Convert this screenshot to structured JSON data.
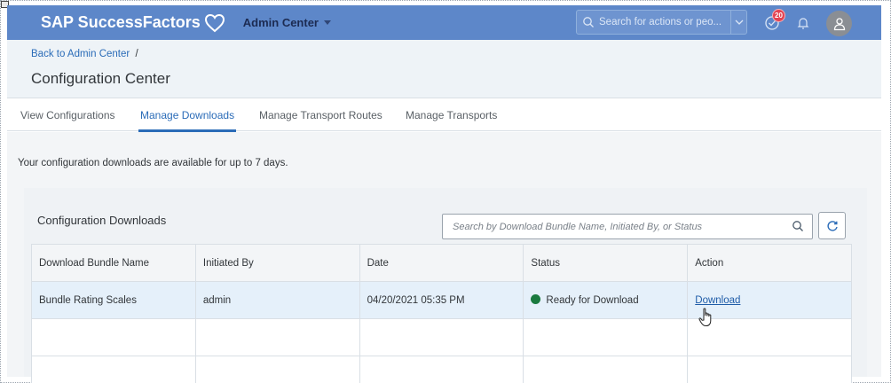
{
  "shell": {
    "brand": "SAP SuccessFactors",
    "admin_center": "Admin Center",
    "search_placeholder": "Search for actions or peo...",
    "notification_count": "20"
  },
  "page": {
    "breadcrumb": "Back to Admin Center",
    "breadcrumb_separator": "/",
    "title": "Configuration Center"
  },
  "tabs": [
    {
      "label": "View Configurations"
    },
    {
      "label": "Manage Downloads"
    },
    {
      "label": "Manage Transport Routes"
    },
    {
      "label": "Manage Transports"
    }
  ],
  "content": {
    "info_text": "Your configuration downloads are available for up to 7 days.",
    "panel_title": "Configuration Downloads",
    "search_placeholder": "Search by Download Bundle Name, Initiated By, or Status"
  },
  "table": {
    "headers": [
      "Download Bundle Name",
      "Initiated By",
      "Date",
      "Status",
      "Action"
    ],
    "rows": [
      {
        "bundle_name": "Bundle Rating Scales",
        "initiated_by": "admin",
        "date": "04/20/2021 05:35 PM",
        "status": "Ready for Download",
        "action": "Download"
      }
    ]
  },
  "colors": {
    "shell": "#5d87c9",
    "link": "#2b6cb8",
    "status_ready": "#1a7a3f",
    "badge": "#e34352"
  },
  "icons": [
    "heart-icon",
    "caret-down-icon",
    "search-icon",
    "dropdown-icon",
    "notifications-icon",
    "bell-icon",
    "user-avatar-icon",
    "refresh-icon",
    "hand-cursor-icon"
  ]
}
